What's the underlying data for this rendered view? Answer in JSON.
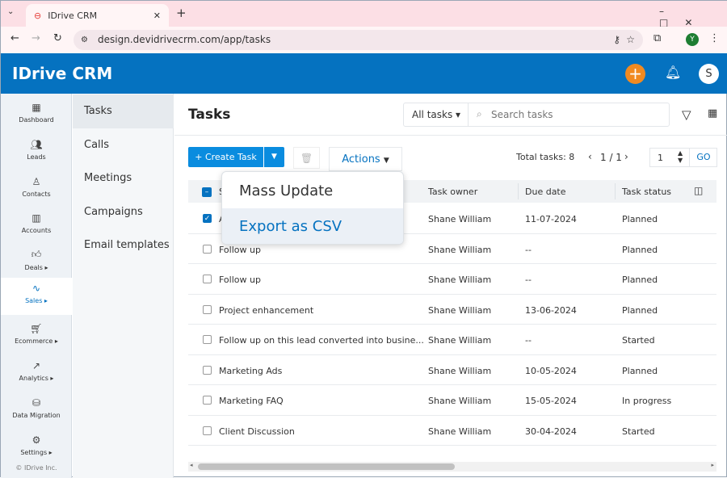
{
  "browser": {
    "tab_title": "IDrive CRM",
    "url": "design.devidrivecrm.com/app/tasks",
    "profile_initial": "Y"
  },
  "header": {
    "logo": "IDrive CRM",
    "avatar_initial": "S",
    "accent": "#0572c0",
    "add_color": "#f18a21"
  },
  "sidebar": {
    "items": [
      {
        "label": "Dashboard",
        "icon": "dashboard-icon"
      },
      {
        "label": "Leads",
        "icon": "leads-icon"
      },
      {
        "label": "Contacts",
        "icon": "contacts-icon"
      },
      {
        "label": "Accounts",
        "icon": "accounts-icon"
      },
      {
        "label": "Deals ▸",
        "icon": "deals-icon"
      },
      {
        "label": "Sales ▸",
        "icon": "sales-icon",
        "active": true
      },
      {
        "label": "Ecommerce ▸",
        "icon": "cart-icon"
      },
      {
        "label": "Analytics ▸",
        "icon": "analytics-icon"
      },
      {
        "label": "Data Migration",
        "icon": "database-icon"
      },
      {
        "label": "Settings ▸",
        "icon": "gear-icon"
      }
    ],
    "footer": "© IDrive Inc."
  },
  "submenu": {
    "items": [
      "Tasks",
      "Calls",
      "Meetings",
      "Campaigns",
      "Email templates"
    ]
  },
  "main": {
    "title": "Tasks",
    "filter": "All tasks",
    "search_placeholder": "Search tasks",
    "create_label": "+ Create Task",
    "actions_label": "Actions",
    "total_label": "Total tasks:",
    "total": "8",
    "page_info": "1 / 1",
    "page_input": "1",
    "go_label": "GO"
  },
  "menu": {
    "items": [
      "Mass Update",
      "Export as CSV"
    ]
  },
  "table": {
    "columns": [
      "S",
      "Task owner",
      "Due date",
      "Task status"
    ],
    "rows": [
      {
        "subject": "A",
        "owner": "Shane William",
        "due": "11-07-2024",
        "status": "Planned",
        "checked": true
      },
      {
        "subject": "Follow up",
        "owner": "Shane William",
        "due": "--",
        "status": "Planned"
      },
      {
        "subject": "Follow up",
        "owner": "Shane William",
        "due": "--",
        "status": "Planned"
      },
      {
        "subject": "Project enhancement",
        "owner": "Shane William",
        "due": "13-06-2024",
        "status": "Planned"
      },
      {
        "subject": "Follow up on this lead converted into busine...",
        "owner": "Shane William",
        "due": "--",
        "status": "Started"
      },
      {
        "subject": "Marketing Ads",
        "owner": "Shane William",
        "due": "10-05-2024",
        "status": "Planned"
      },
      {
        "subject": "Marketing FAQ",
        "owner": "Shane William",
        "due": "15-05-2024",
        "status": "In progress"
      },
      {
        "subject": "Client Discussion",
        "owner": "Shane William",
        "due": "30-04-2024",
        "status": "Started"
      }
    ]
  }
}
